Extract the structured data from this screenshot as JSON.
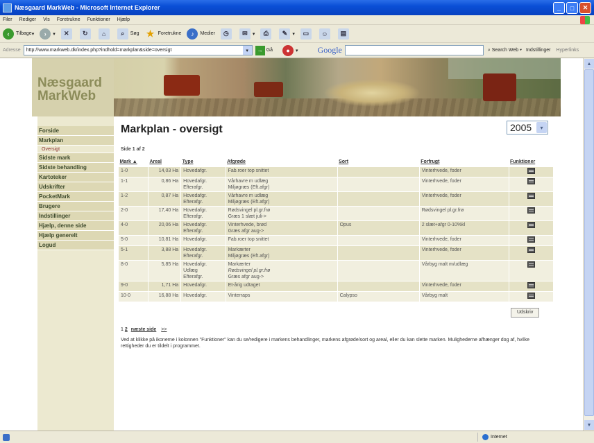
{
  "window": {
    "title": "Næsgaard MarkWeb - Microsoft Internet Explorer"
  },
  "menu": [
    "Filer",
    "Rediger",
    "Vis",
    "Foretrukne",
    "Funktioner",
    "Hjælp"
  ],
  "toolbar": {
    "back": "Tilbage",
    "search": "Søg",
    "favorites": "Foretrukne",
    "media": "Medier"
  },
  "address": {
    "label": "Adresse",
    "url": "http://www.markweb.dk/index.php?indhold=markplan&side=oversigt",
    "go": "Gå"
  },
  "google": {
    "logo": "Google",
    "search_web": "Search Web",
    "options": "Indstillinger",
    "hyperlinks": "Hyperlinks"
  },
  "site": {
    "logo_line1": "Næsgaard",
    "logo_line2": "MarkWeb"
  },
  "nav": {
    "items": [
      {
        "label": "Forside"
      },
      {
        "label": "Markplan"
      },
      {
        "label": "Oversigt",
        "sub": true
      },
      {
        "label": "Sidste mark"
      },
      {
        "label": "Sidste behandling"
      },
      {
        "label": "Kartoteker"
      },
      {
        "label": "Udskrifter"
      },
      {
        "label": "PocketMark"
      },
      {
        "label": "Brugere"
      },
      {
        "label": "Indstillinger"
      },
      {
        "label": "Hjælp, denne side"
      },
      {
        "label": "Hjælp generelt"
      },
      {
        "label": "Logud"
      }
    ]
  },
  "main": {
    "title": "Markplan - oversigt",
    "year": "2005",
    "page_info": "Side 1 af 2",
    "columns": [
      "Mark ▲",
      "Areal",
      "Type",
      "Afgrøde",
      "Sort",
      "Forfrugt",
      "Funktioner"
    ],
    "rows": [
      {
        "mark": "1-0",
        "areal": "14,03 Ha",
        "type": [
          "Hovedafgr."
        ],
        "afgrode": [
          "Fab.roer top snittet"
        ],
        "sort": "",
        "forfrugt": "Vinterhvede, foder"
      },
      {
        "mark": "1-1",
        "areal": "0,86 Ha",
        "type": [
          "Hovedafgr.",
          "Efterafgr."
        ],
        "afgrode": [
          "Vårhavre m udlæg",
          "Miljøgræs (Eft.afgr)"
        ],
        "sort": "",
        "forfrugt": "Vinterhvede, foder"
      },
      {
        "mark": "1-2",
        "areal": "0,87 Ha",
        "type": [
          "Hovedafgr.",
          "Efterafgr."
        ],
        "afgrode": [
          "Vårhavre m udlæg",
          "Miljøgræs (Eft.afgr)"
        ],
        "sort": "",
        "forfrugt": "Vinterhvede, foder"
      },
      {
        "mark": "2-0",
        "areal": "17,40 Ha",
        "type": [
          "Hovedafgr.",
          "Efterafgr."
        ],
        "afgrode": [
          "Rødsvingel pl.gr.frø",
          "Græs 1 slæt juli->"
        ],
        "sort": "",
        "forfrugt": "Rødsvingel pl.gr.frø"
      },
      {
        "mark": "4-0",
        "areal": "20,06 Ha",
        "type": [
          "Hovedafgr.",
          "Efterafgr."
        ],
        "afgrode": [
          "Vinterhvede, brød",
          "Græs afgr aug->"
        ],
        "sort": "Opus",
        "forfrugt": "2 slæt+afgr 0-10%kl"
      },
      {
        "mark": "5-0",
        "areal": "10,81 Ha",
        "type": [
          "Hovedafgr."
        ],
        "afgrode": [
          "Fab.roer top snittet"
        ],
        "sort": "",
        "forfrugt": "Vinterhvede, foder"
      },
      {
        "mark": "5-1",
        "areal": "3,88 Ha",
        "type": [
          "Hovedafgr.",
          "Efterafgr."
        ],
        "afgrode": [
          "Markærter",
          "Miljøgræs (Eft.afgr)"
        ],
        "sort": "",
        "forfrugt": "Vinterhvede, foder"
      },
      {
        "mark": "8-0",
        "areal": "5,85 Ha",
        "type": [
          "Hovedafgr.",
          "Udlæg",
          "Efterafgr."
        ],
        "afgrode": [
          "Markærter",
          "Rødsvingel pl.gr.frø",
          "Græs afgr aug->"
        ],
        "sort": "",
        "forfrugt": "Vårbyg malt m/udlæg"
      },
      {
        "mark": "9-0",
        "areal": "1,71 Ha",
        "type": [
          "Hovedafgr."
        ],
        "afgrode": [
          "Et-årig udtaget"
        ],
        "sort": "",
        "forfrugt": "Vinterhvede, foder"
      },
      {
        "mark": "10-0",
        "areal": "16,88 Ha",
        "type": [
          "Hovedafgr."
        ],
        "afgrode": [
          "Vinterraps"
        ],
        "sort": "Calypso",
        "forfrugt": "Vårbyg malt"
      }
    ],
    "print_label": "Udskriv",
    "pager_current": "1",
    "pager_page2": "2",
    "pager_next": "næste side",
    "pager_next_arrow": ">>",
    "note": "Ved at klikke på ikonerne i kolonnen \"Funktioner\" kan du se/redigere i markens behandlinger, markens afgrøde/sort og areal, eller du kan slette marken. Mulighederne afhænger dog af, hvilke rettigheder du er tildelt i programmet."
  },
  "status": {
    "zone": "Internet"
  },
  "colors": {
    "titlebar": "#0a4fd6",
    "nav_bg": "#ddd8b4",
    "row_dark": "#e5e2c6",
    "row_light": "#f1efdf"
  }
}
